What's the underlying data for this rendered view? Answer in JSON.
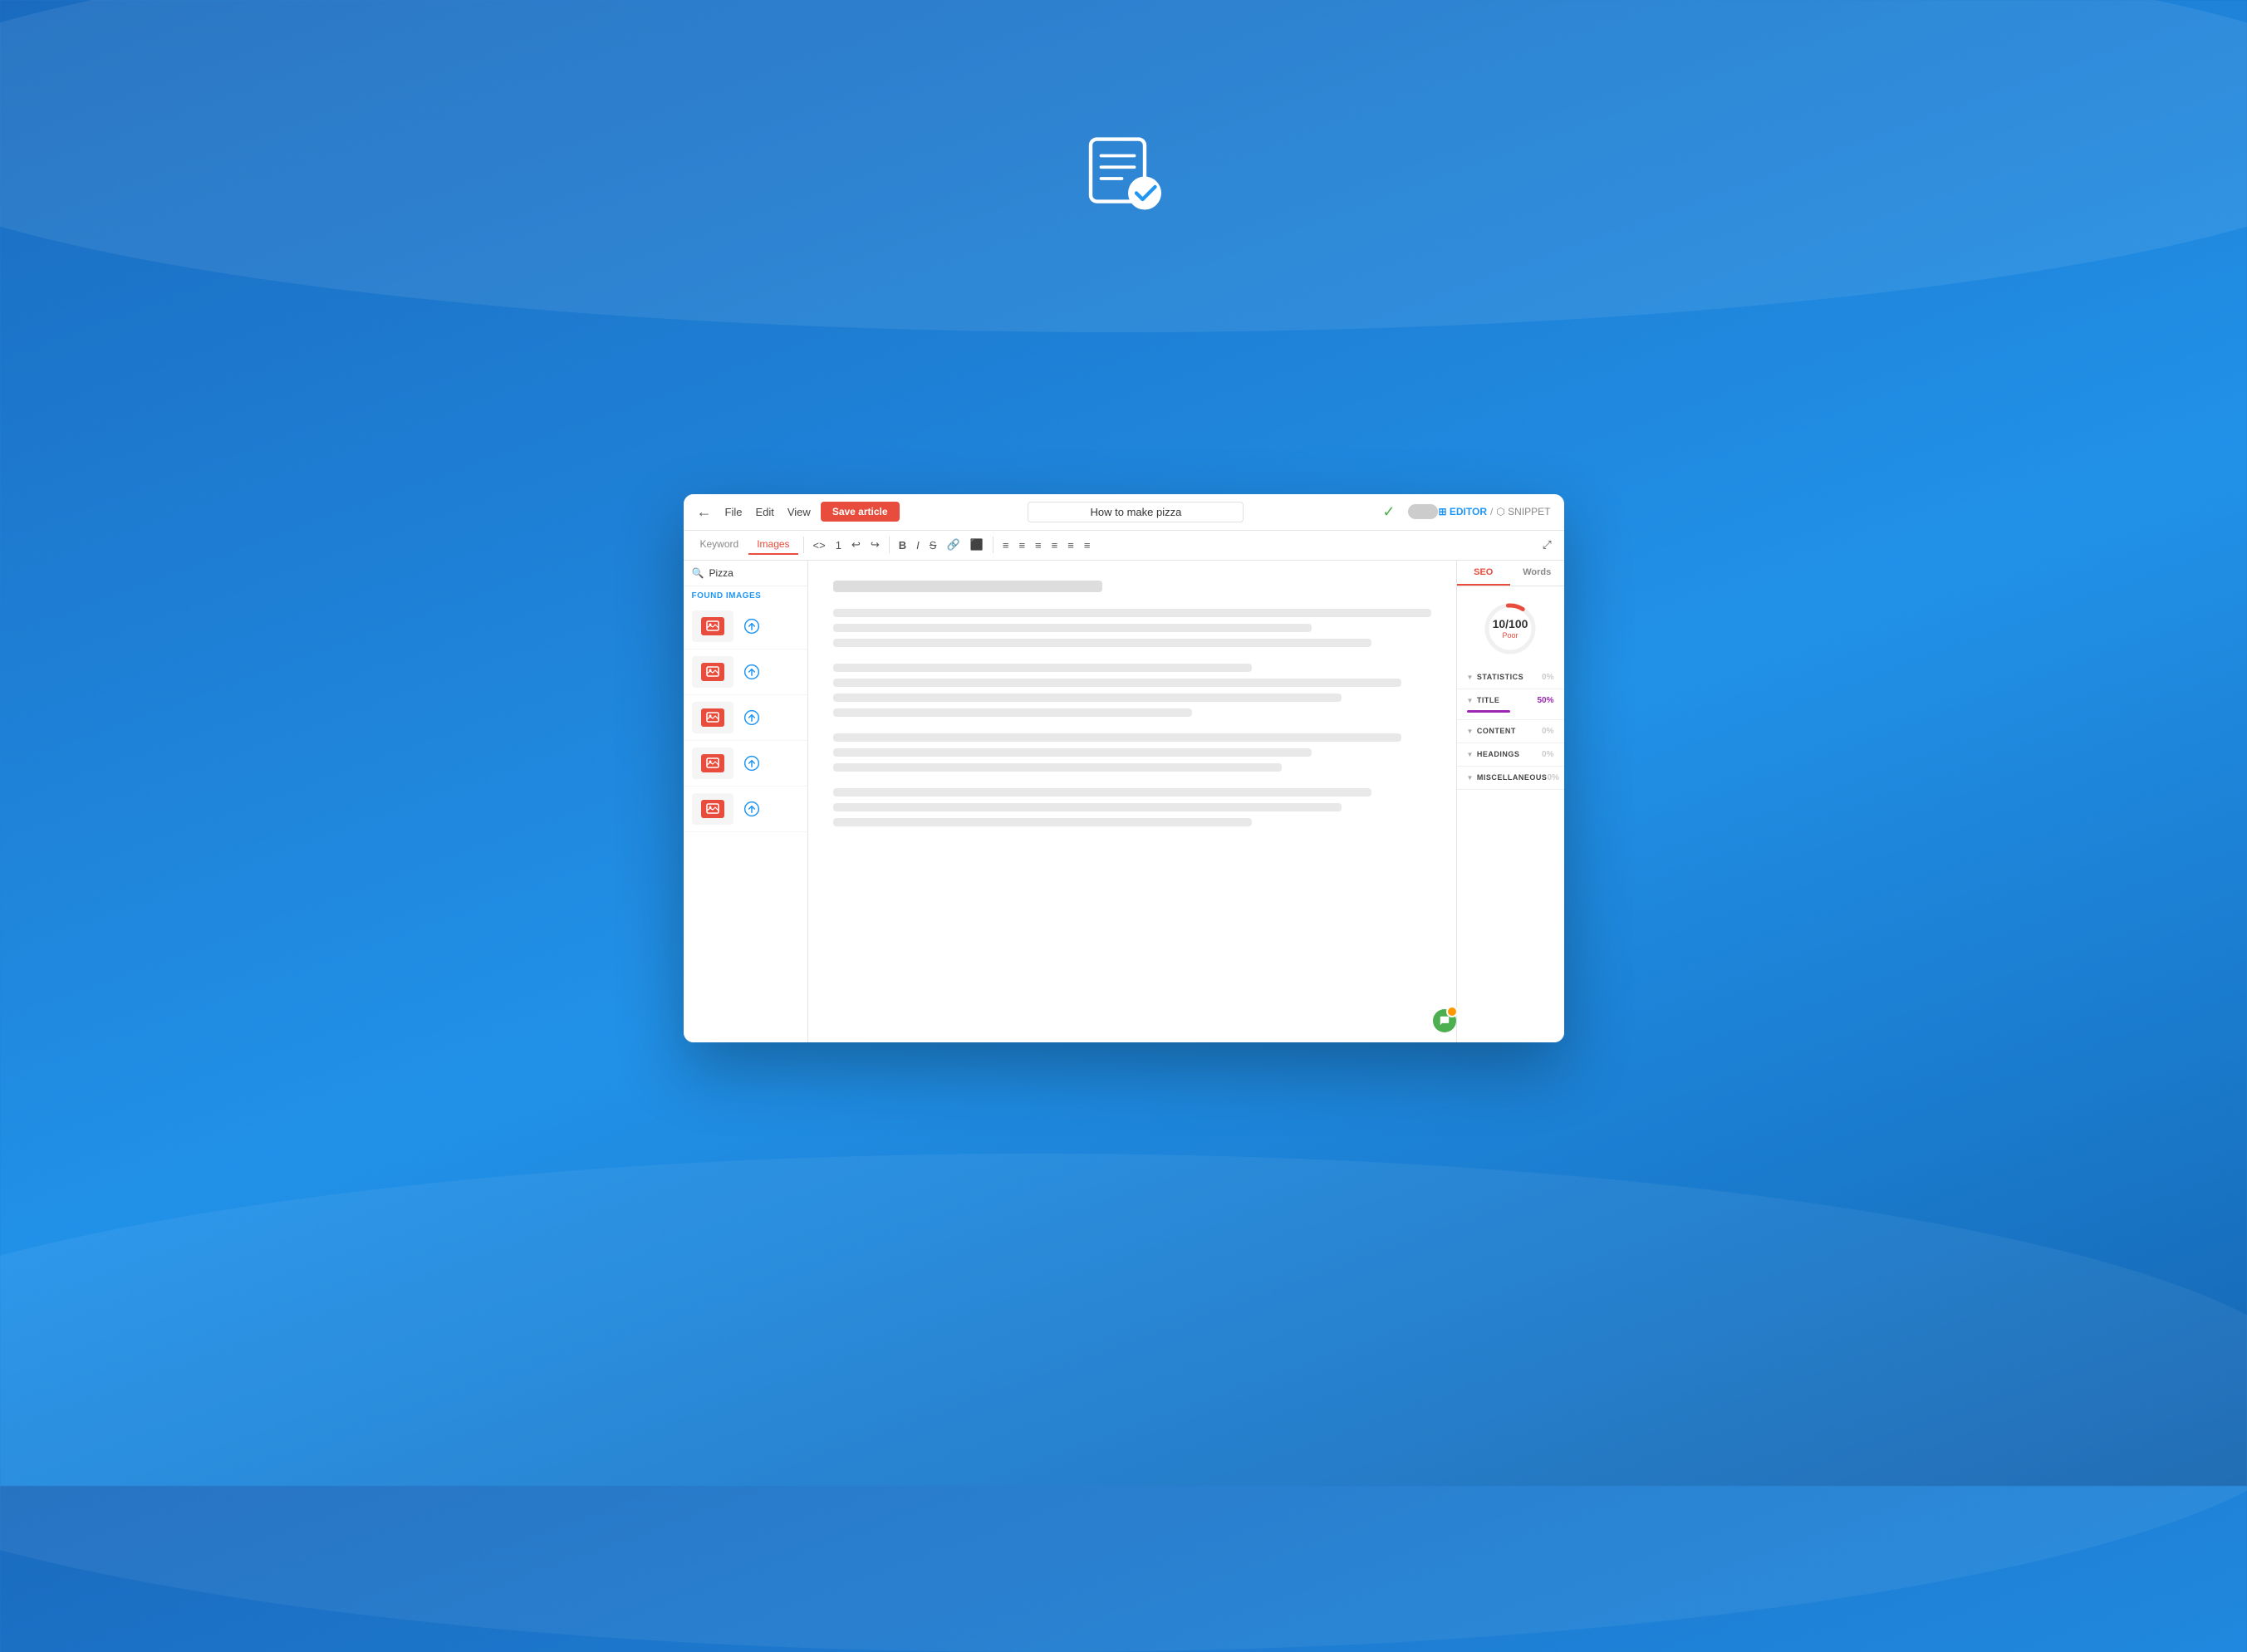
{
  "background": {
    "gradient_start": "#1a6bbf",
    "gradient_end": "#1565b0"
  },
  "top_icon": {
    "alt": "article-check-icon"
  },
  "editor": {
    "title_bar": {
      "back_label": "←",
      "menu": [
        {
          "label": "File"
        },
        {
          "label": "Edit"
        },
        {
          "label": "View"
        }
      ],
      "save_button": "Save article",
      "title_value": "How to make pizza",
      "check_mark": "✓",
      "toggle_label": "",
      "tab_editor_label": "⊞ EDITOR",
      "tab_sep": "/",
      "tab_snippet_label": "⬡ SNIPPET"
    },
    "toolbar": {
      "tabs": [
        {
          "label": "Keyword",
          "active": false
        },
        {
          "label": "Images",
          "active": true
        }
      ],
      "buttons": [
        "<>",
        "1",
        "↩",
        "↪",
        "B",
        "I",
        "S",
        "🔗",
        "⬛",
        "≡",
        "≡",
        "≡",
        "≡",
        "≡",
        "≡"
      ],
      "fullscreen": "⤢"
    },
    "left_sidebar": {
      "search_placeholder": "Pizza",
      "found_label": "FOUND IMAGES",
      "images": [
        {
          "id": 1
        },
        {
          "id": 2
        },
        {
          "id": 3
        },
        {
          "id": 4
        },
        {
          "id": 5
        }
      ]
    },
    "content": {
      "blocks": [
        {
          "title_width": "45%",
          "lines": []
        },
        {
          "lines": [
            "100%",
            "80%",
            "95%"
          ]
        },
        {
          "lines": [
            "70%",
            "90%",
            "60%",
            "85%"
          ]
        },
        {
          "lines": [
            "95%",
            "85%",
            "75%"
          ]
        }
      ]
    },
    "seo_panel": {
      "tabs": [
        {
          "label": "SEO",
          "active": true
        },
        {
          "label": "Words",
          "active": false
        }
      ],
      "score": {
        "value": "10/100",
        "label": "Poor",
        "numerator": "10",
        "denominator": "100"
      },
      "sections": [
        {
          "key": "statistics",
          "label": "STATISTICS",
          "percent": "0%",
          "percent_class": "pct-zero",
          "bar": false
        },
        {
          "key": "title",
          "label": "TITLE",
          "percent": "50%",
          "percent_class": "pct-purple",
          "bar": true,
          "bar_class": "bar-purple"
        },
        {
          "key": "content",
          "label": "CONTENT",
          "percent": "0%",
          "percent_class": "pct-zero",
          "bar": false
        },
        {
          "key": "headings",
          "label": "HEADINGS",
          "percent": "0%",
          "percent_class": "pct-zero",
          "bar": false
        },
        {
          "key": "miscellaneous",
          "label": "MISCELLANEOUS",
          "percent": "0%",
          "percent_class": "pct-zero",
          "bar": false
        }
      ]
    }
  }
}
